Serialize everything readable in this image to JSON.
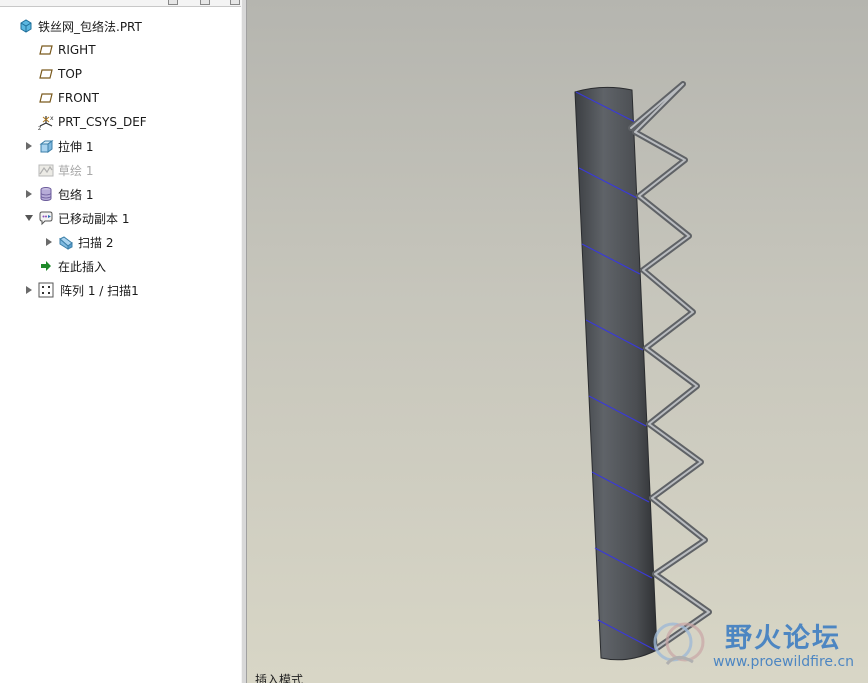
{
  "model_tree": {
    "root": {
      "label": "铁丝网_包络法.PRT",
      "icon": "part-icon"
    },
    "items": [
      {
        "label": "RIGHT",
        "icon": "datum-plane-icon",
        "expandable": false,
        "dim": false
      },
      {
        "label": "TOP",
        "icon": "datum-plane-icon",
        "expandable": false,
        "dim": false
      },
      {
        "label": "FRONT",
        "icon": "datum-plane-icon",
        "expandable": false,
        "dim": false
      },
      {
        "label": "PRT_CSYS_DEF",
        "icon": "coordinate-system-icon",
        "expandable": false,
        "dim": false
      },
      {
        "label": "拉伸 1",
        "icon": "extrude-icon",
        "expandable": true,
        "expanded": false,
        "dim": false
      },
      {
        "label": "草绘 1",
        "icon": "sketch-icon",
        "expandable": false,
        "dim": true
      },
      {
        "label": "包络 1",
        "icon": "wrap-icon",
        "expandable": true,
        "expanded": false,
        "dim": false
      },
      {
        "label": "已移动副本 1",
        "icon": "moved-copy-icon",
        "expandable": true,
        "expanded": true,
        "dim": false
      },
      {
        "label": "扫描 2",
        "icon": "sweep-icon",
        "expandable": true,
        "expanded": false,
        "dim": false
      },
      {
        "label": "在此插入",
        "icon": "insert-here-arrow-icon",
        "expandable": false,
        "dim": false
      },
      {
        "label": "阵列 1 / 扫描1",
        "icon": "pattern-icon",
        "expandable": true,
        "expanded": false,
        "dim": false
      }
    ]
  },
  "status": {
    "text": "插入模式"
  },
  "watermark": {
    "title": "野火论坛",
    "url": "www.proewildfire.cn",
    "icon": "forum-logo-icon"
  },
  "colors": {
    "tree_background": "#ffffff",
    "viewport_top": "#b5b5af",
    "viewport_bottom": "#d8d6c6",
    "cylinder": "#55585c",
    "wrap_curve": "#3a3ad6",
    "spring_wire": "#6e7074",
    "watermark": "#3f7ec2"
  }
}
